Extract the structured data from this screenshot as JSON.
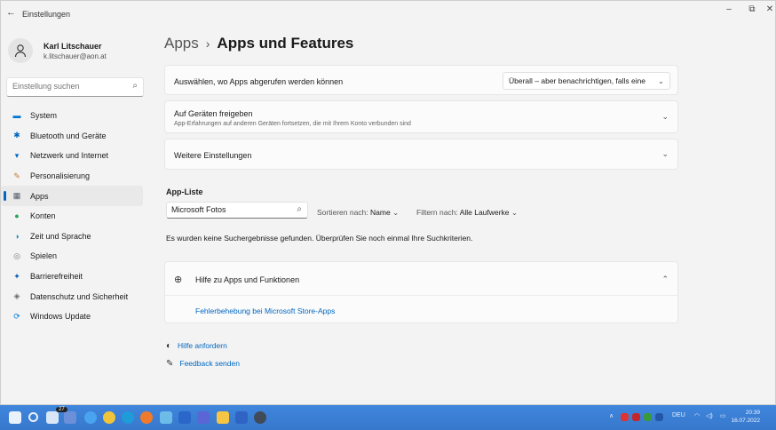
{
  "window": {
    "title": "Einstellungen",
    "back_glyph": "←",
    "minimize_glyph": "–",
    "maximize_glyph": "⧉",
    "close_glyph": "✕"
  },
  "profile": {
    "name": "Karl Litschauer",
    "email": "k.litschauer@aon.at"
  },
  "sidebar_search": {
    "placeholder": "Einstellung suchen",
    "icon": "search-icon"
  },
  "nav": {
    "items": [
      {
        "label": "System",
        "icon": "monitor-icon",
        "color": "#0078d4"
      },
      {
        "label": "Bluetooth und Geräte",
        "icon": "bluetooth-icon",
        "color": "#0067c0"
      },
      {
        "label": "Netzwerk und Internet",
        "icon": "wifi-icon",
        "color": "#0067c0"
      },
      {
        "label": "Personalisierung",
        "icon": "brush-icon",
        "color": "#c27b2e"
      },
      {
        "label": "Apps",
        "icon": "apps-icon",
        "color": "#505a66"
      },
      {
        "label": "Konten",
        "icon": "person-icon",
        "color": "#2aa160"
      },
      {
        "label": "Zeit und Sprache",
        "icon": "clock-globe-icon",
        "color": "#1e88b8"
      },
      {
        "label": "Spielen",
        "icon": "gamepad-icon",
        "color": "#7a7a7a"
      },
      {
        "label": "Barrierefreiheit",
        "icon": "accessibility-icon",
        "color": "#0a5fb4"
      },
      {
        "label": "Datenschutz und Sicherheit",
        "icon": "shield-icon",
        "color": "#6b6b6b"
      },
      {
        "label": "Windows Update",
        "icon": "update-icon",
        "color": "#0078d4"
      }
    ],
    "active_index": 4
  },
  "breadcrumb": {
    "parent": "Apps",
    "separator": "›",
    "current": "Apps und Features"
  },
  "cards": {
    "source": {
      "label": "Auswählen, wo Apps abgerufen werden können",
      "dropdown_value": "Überall – aber benachrichtigen, falls eine"
    },
    "share": {
      "label": "Auf Geräten freigeben",
      "sublabel": "App-Erfahrungen auf anderen Geräten fortsetzen, die mit Ihrem Konto verbunden sind"
    },
    "more": {
      "label": "Weitere Einstellungen"
    }
  },
  "app_list": {
    "title": "App-Liste",
    "search_value": "Microsoft Fotos",
    "sort_label": "Sortieren nach:",
    "sort_value": "Name",
    "filter_label": "Filtern nach:",
    "filter_value": "Alle Laufwerke",
    "no_results": "Es wurden keine Suchergebnisse gefunden. Überprüfen Sie noch einmal Ihre Suchkriterien."
  },
  "help": {
    "title": "Hilfe zu Apps und Funktionen",
    "link": "Fehlerbehebung bei Microsoft Store-Apps"
  },
  "bottom_links": {
    "help": "Hilfe anfordern",
    "feedback": "Feedback senden"
  },
  "taskbar": {
    "badge": "27",
    "language": "DEU",
    "time": "20:39",
    "date": "16.07.2022"
  },
  "colors": {
    "accent": "#0067c0",
    "taskbar": "#3b7fd6"
  }
}
